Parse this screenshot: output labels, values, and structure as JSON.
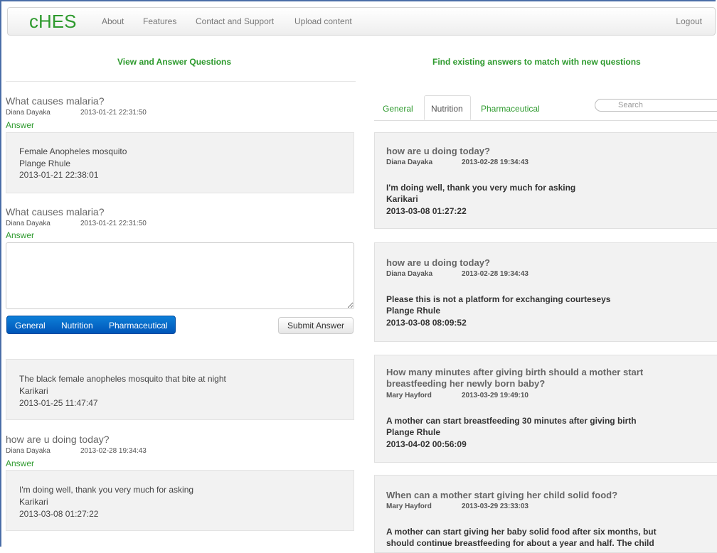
{
  "navbar": {
    "brand": "cHES",
    "links": [
      "About",
      "Features",
      "Contact and Support",
      "Upload content"
    ],
    "logout": "Logout"
  },
  "left": {
    "section_title": "View and Answer Questions",
    "questions": [
      {
        "title": "What causes malaria?",
        "author": "Diana Dayaka",
        "date": "2013-01-21 22:31:50",
        "answer_link": "Answer",
        "answer": {
          "text": "Female Anopheles mosquito",
          "author": "Plange Rhule",
          "date": "2013-01-21 22:38:01"
        }
      },
      {
        "title": "What causes malaria?",
        "author": "Diana Dayaka",
        "date": "2013-01-21 22:31:50",
        "answer_link": "Answer"
      },
      {
        "answer": {
          "text": "The black female anopheles mosquito that bite at night",
          "author": "Karikari",
          "date": "2013-01-25 11:47:47"
        }
      },
      {
        "title": "how are u doing today?",
        "author": "Diana Dayaka",
        "date": "2013-02-28 19:34:43",
        "answer_link": "Answer",
        "answer": {
          "text": "I'm doing well, thank you very much for asking",
          "author": "Karikari",
          "date": "2013-03-08 01:27:22"
        }
      }
    ],
    "category_buttons": [
      "General",
      "Nutrition",
      "Pharmaceutical"
    ],
    "submit_label": "Submit Answer"
  },
  "right": {
    "section_title": "Find existing answers to match with new questions",
    "tabs": [
      "General",
      "Nutrition",
      "Pharmaceutical"
    ],
    "active_tab": "Nutrition",
    "search_placeholder": "Search",
    "cards": [
      {
        "title": "how are u doing today?",
        "author": "Diana Dayaka",
        "date": "2013-02-28 19:34:43",
        "answer": "I'm doing well, thank you very much for asking",
        "answer_author": "Karikari",
        "answer_date": "2013-03-08 01:27:22"
      },
      {
        "title": "how are u doing today?",
        "author": "Diana Dayaka",
        "date": "2013-02-28 19:34:43",
        "answer": "Please this is not a platform for exchanging courteseys",
        "answer_author": "Plange Rhule",
        "answer_date": "2013-03-08 08:09:52"
      },
      {
        "title_line1": "How many minutes after giving birth should a mother start",
        "title_line2": "breastfeeding her newly born baby?",
        "author": "Mary Hayford",
        "date": "2013-03-29 19:49:10",
        "answer": "A mother can start breastfeeding 30 minutes after giving birth",
        "answer_author": "Plange Rhule",
        "answer_date": "2013-04-02 00:56:09"
      },
      {
        "title": "When can a mother start giving her child solid food?",
        "author": "Mary Hayford",
        "date": "2013-03-29 23:33:03",
        "answer_line1": "A mother can start giving her baby solid food after six months, but",
        "answer_line2": "should continue breastfeeding for about a year and half. The child"
      }
    ]
  },
  "colors": {
    "accent": "#2e9a2e",
    "primary_button": "#0d6fd0"
  }
}
